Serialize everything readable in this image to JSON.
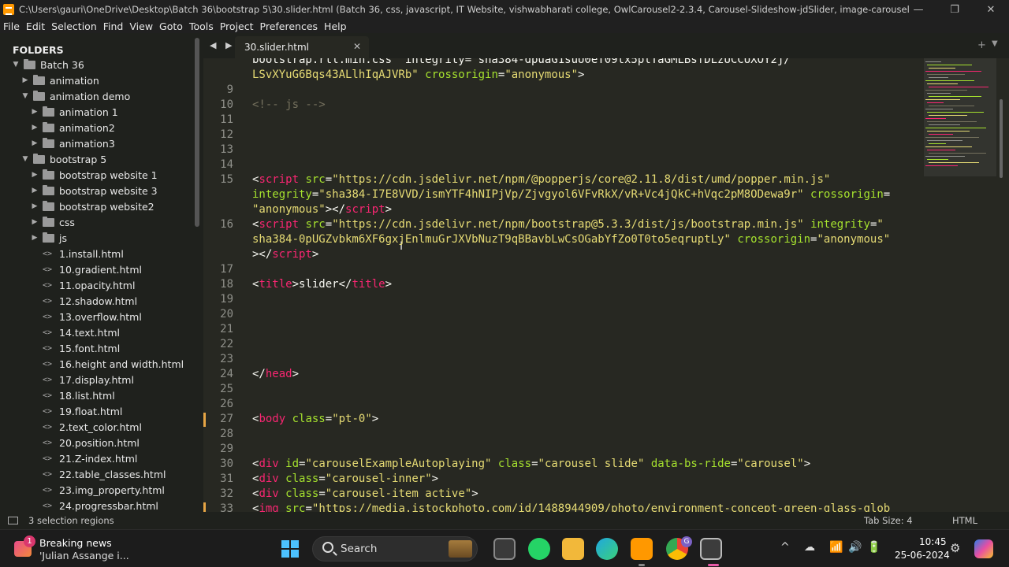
{
  "window": {
    "title": "C:\\Users\\gauri\\OneDrive\\Desktop\\Batch 36\\bootstrap 5\\30.slider.html (Batch 36, css, javascript, IT Website, vishwabharati college, OwlCarousel2-2.3.4, Carousel-Slideshow-jdSlider, image-carousel-scroll, my_pro...",
    "minimize": "—",
    "maximize": "❐",
    "close": "✕"
  },
  "menu": [
    "File",
    "Edit",
    "Selection",
    "Find",
    "View",
    "Goto",
    "Tools",
    "Project",
    "Preferences",
    "Help"
  ],
  "sidebar": {
    "title": "FOLDERS",
    "items": [
      {
        "label": "Batch 36",
        "type": "folder",
        "depth": 0,
        "expanded": true
      },
      {
        "label": "animation",
        "type": "folder",
        "depth": 1,
        "expanded": false
      },
      {
        "label": "animation demo",
        "type": "folder",
        "depth": 1,
        "expanded": true
      },
      {
        "label": "animation 1",
        "type": "folder",
        "depth": 2,
        "expanded": false
      },
      {
        "label": "animation2",
        "type": "folder",
        "depth": 2,
        "expanded": false
      },
      {
        "label": "animation3",
        "type": "folder",
        "depth": 2,
        "expanded": false
      },
      {
        "label": "bootstrap 5",
        "type": "folder",
        "depth": 1,
        "expanded": true
      },
      {
        "label": "bootstrap website 1",
        "type": "folder",
        "depth": 2,
        "expanded": false
      },
      {
        "label": "bootstrap website 3",
        "type": "folder",
        "depth": 2,
        "expanded": false
      },
      {
        "label": "bootstrap website2",
        "type": "folder",
        "depth": 2,
        "expanded": false
      },
      {
        "label": "css",
        "type": "folder",
        "depth": 2,
        "expanded": false
      },
      {
        "label": "js",
        "type": "folder",
        "depth": 2,
        "expanded": false
      },
      {
        "label": "1.install.html",
        "type": "file",
        "depth": 2
      },
      {
        "label": "10.gradient.html",
        "type": "file",
        "depth": 2
      },
      {
        "label": "11.opacity.html",
        "type": "file",
        "depth": 2
      },
      {
        "label": "12.shadow.html",
        "type": "file",
        "depth": 2
      },
      {
        "label": "13.overflow.html",
        "type": "file",
        "depth": 2
      },
      {
        "label": "14.text.html",
        "type": "file",
        "depth": 2
      },
      {
        "label": "15.font.html",
        "type": "file",
        "depth": 2
      },
      {
        "label": "16.height and width.html",
        "type": "file",
        "depth": 2
      },
      {
        "label": "17.display.html",
        "type": "file",
        "depth": 2
      },
      {
        "label": "18.list.html",
        "type": "file",
        "depth": 2
      },
      {
        "label": "19.float.html",
        "type": "file",
        "depth": 2
      },
      {
        "label": "2.text_color.html",
        "type": "file",
        "depth": 2
      },
      {
        "label": "20.position.html",
        "type": "file",
        "depth": 2
      },
      {
        "label": "21.Z-index.html",
        "type": "file",
        "depth": 2
      },
      {
        "label": "22.table_classes.html",
        "type": "file",
        "depth": 2
      },
      {
        "label": "23.img_property.html",
        "type": "file",
        "depth": 2
      },
      {
        "label": "24.progressbar.html",
        "type": "file",
        "depth": 2
      }
    ]
  },
  "tabs": {
    "nav": "◀ ▶",
    "active": "30.slider.html",
    "close": "✕",
    "add": "+",
    "menu": "▼"
  },
  "editor": {
    "lines": [
      {
        "num": "",
        "segs": [
          [
            "t-txt",
            "bootstrap.rtl.min.css\" integrity=\"sha384-dpuaG1suU0eT09tx5plTaGMLBsfDLzUCCUXOY2j/"
          ]
        ]
      },
      {
        "num": "",
        "segs": [
          [
            "t-str",
            "LSvXYuG6Bqs43ALlhIqAJVRb\""
          ],
          [
            "t-txt",
            " "
          ],
          [
            "t-attr",
            "crossorigin"
          ],
          [
            "t-txt",
            "="
          ],
          [
            "t-str",
            "\"anonymous\""
          ],
          [
            "t-txt",
            ">"
          ]
        ]
      },
      {
        "num": "9",
        "segs": []
      },
      {
        "num": "10",
        "segs": [
          [
            "t-cmt",
            "<!-- js -->"
          ]
        ]
      },
      {
        "num": "11",
        "segs": []
      },
      {
        "num": "12",
        "segs": []
      },
      {
        "num": "13",
        "segs": []
      },
      {
        "num": "14",
        "segs": []
      },
      {
        "num": "15",
        "segs": [
          [
            "t-txt",
            "<"
          ],
          [
            "t-tag",
            "script"
          ],
          [
            "t-txt",
            " "
          ],
          [
            "t-attr",
            "src"
          ],
          [
            "t-txt",
            "="
          ],
          [
            "t-str",
            "\"https://cdn.jsdelivr.net/npm/@popperjs/core@2.11.8/dist/umd/popper.min.js\""
          ]
        ]
      },
      {
        "num": "",
        "segs": [
          [
            "t-attr",
            "integrity"
          ],
          [
            "t-txt",
            "="
          ],
          [
            "t-str",
            "\"sha384-I7E8VVD/ismYTF4hNIPjVp/Zjvgyol6VFvRkX/vR+Vc4jQkC+hVqc2pM8ODewa9r\""
          ],
          [
            "t-txt",
            " "
          ],
          [
            "t-attr",
            "crossorigin"
          ],
          [
            "t-txt",
            "="
          ]
        ]
      },
      {
        "num": "",
        "segs": [
          [
            "t-str",
            "\"anonymous\""
          ],
          [
            "t-txt",
            "></"
          ],
          [
            "t-tag",
            "script"
          ],
          [
            "t-txt",
            ">"
          ]
        ]
      },
      {
        "num": "16",
        "segs": [
          [
            "t-txt",
            "<"
          ],
          [
            "t-tag",
            "script"
          ],
          [
            "t-txt",
            " "
          ],
          [
            "t-attr",
            "src"
          ],
          [
            "t-txt",
            "="
          ],
          [
            "t-str",
            "\"https://cdn.jsdelivr.net/npm/bootstrap@5.3.3/dist/js/bootstrap.min.js\""
          ],
          [
            "t-txt",
            " "
          ],
          [
            "t-attr",
            "integrity"
          ],
          [
            "t-txt",
            "="
          ],
          [
            "t-str",
            "\""
          ]
        ]
      },
      {
        "num": "",
        "segs": [
          [
            "t-str",
            "sha384-0pUGZvbkm6XF6gxjEnlmuGrJXVbNuzT9qBBavbLwCsOGabYfZo0T0to5eqruptLy\""
          ],
          [
            "t-txt",
            " "
          ],
          [
            "t-attr",
            "crossorigin"
          ],
          [
            "t-txt",
            "="
          ],
          [
            "t-str",
            "\"anonymous\""
          ]
        ]
      },
      {
        "num": "",
        "segs": [
          [
            "t-txt",
            "></"
          ],
          [
            "t-tag",
            "script"
          ],
          [
            "t-txt",
            ">"
          ]
        ]
      },
      {
        "num": "17",
        "segs": []
      },
      {
        "num": "18",
        "segs": [
          [
            "t-txt",
            "<"
          ],
          [
            "t-tag",
            "title"
          ],
          [
            "t-txt",
            ">slider</"
          ],
          [
            "t-tag",
            "title"
          ],
          [
            "t-txt",
            ">"
          ]
        ]
      },
      {
        "num": "19",
        "segs": []
      },
      {
        "num": "20",
        "segs": []
      },
      {
        "num": "21",
        "segs": []
      },
      {
        "num": "22",
        "segs": []
      },
      {
        "num": "23",
        "segs": []
      },
      {
        "num": "24",
        "segs": [
          [
            "t-txt",
            "</"
          ],
          [
            "t-tag",
            "head"
          ],
          [
            "t-txt",
            ">"
          ]
        ]
      },
      {
        "num": "25",
        "segs": []
      },
      {
        "num": "26",
        "segs": []
      },
      {
        "num": "27",
        "segs": [
          [
            "t-txt",
            "<"
          ],
          [
            "t-tag",
            "body"
          ],
          [
            "t-txt",
            " "
          ],
          [
            "t-attr",
            "class"
          ],
          [
            "t-txt",
            "="
          ],
          [
            "t-str",
            "\"pt-0\""
          ],
          [
            "t-txt",
            ">"
          ]
        ],
        "modified": true
      },
      {
        "num": "28",
        "segs": []
      },
      {
        "num": "29",
        "segs": []
      },
      {
        "num": "30",
        "segs": [
          [
            "t-txt",
            "<"
          ],
          [
            "t-tag",
            "div"
          ],
          [
            "t-txt",
            " "
          ],
          [
            "t-attr",
            "id"
          ],
          [
            "t-txt",
            "="
          ],
          [
            "t-str",
            "\"carouselExampleAutoplaying\""
          ],
          [
            "t-txt",
            " "
          ],
          [
            "t-attr",
            "class"
          ],
          [
            "t-txt",
            "="
          ],
          [
            "t-str",
            "\"carousel slide\""
          ],
          [
            "t-txt",
            " "
          ],
          [
            "t-attr",
            "data-bs-ride"
          ],
          [
            "t-txt",
            "="
          ],
          [
            "t-str",
            "\"carousel\""
          ],
          [
            "t-txt",
            ">"
          ]
        ]
      },
      {
        "num": "31",
        "segs": [
          [
            "t-txt",
            "<"
          ],
          [
            "t-tag",
            "div"
          ],
          [
            "t-txt",
            " "
          ],
          [
            "t-attr",
            "class"
          ],
          [
            "t-txt",
            "="
          ],
          [
            "t-str",
            "\"carousel-inner\""
          ],
          [
            "t-txt",
            ">"
          ]
        ]
      },
      {
        "num": "32",
        "segs": [
          [
            "t-txt",
            "<"
          ],
          [
            "t-tag",
            "div"
          ],
          [
            "t-txt",
            " "
          ],
          [
            "t-attr",
            "class"
          ],
          [
            "t-txt",
            "="
          ],
          [
            "t-str",
            "\"carousel-item active\""
          ],
          [
            "t-txt",
            ">"
          ]
        ]
      },
      {
        "num": "33",
        "segs": [
          [
            "t-txt",
            "<"
          ],
          [
            "t-tag",
            "img"
          ],
          [
            "t-txt",
            " "
          ],
          [
            "t-attr",
            "src"
          ],
          [
            "t-txt",
            "="
          ],
          [
            "t-str",
            "\"https://media.istockphoto.com/id/1488944909/photo/environment-concept-green-glass-glob"
          ]
        ],
        "modified": true
      }
    ]
  },
  "status": {
    "selection": "3 selection regions",
    "tab_size": "Tab Size: 4",
    "syntax": "HTML"
  },
  "taskbar": {
    "news_badge": "1",
    "news_title": "Breaking news",
    "news_subtitle": "'Julian Assange i...",
    "search_label": "Search",
    "chrome_badge": "G",
    "time": "10:45",
    "date": "25-06-2024",
    "tray": [
      "^",
      "☁",
      "📶",
      "🔊",
      "🔋"
    ]
  },
  "colors": {
    "editor_bg": "#272822",
    "sidebar_bg": "#1f211d",
    "tag": "#f92672",
    "attr": "#a6e22e",
    "string": "#e6db74",
    "comment": "#75715e",
    "modified_marker": "#e6a545"
  }
}
